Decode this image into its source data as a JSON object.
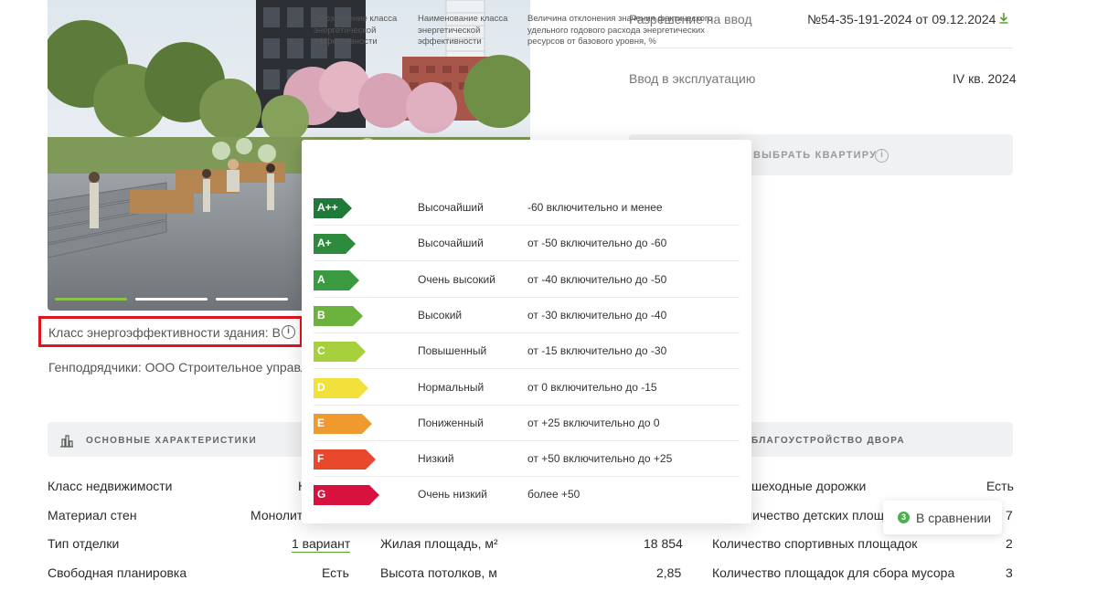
{
  "hero": {
    "slides": 4,
    "active_slide": 1
  },
  "energy": {
    "label": "Класс энергоэффективности здания: В"
  },
  "contractors": {
    "label": "Генподрядчики: ООО Строительное управле"
  },
  "permit": {
    "label": "Разрешение на ввод",
    "value": "№54-35-191-2024 от 09.12.2024"
  },
  "commission": {
    "label": "Ввод в эксплуатацию",
    "value": "IV кв. 2024"
  },
  "choose": {
    "label": "ВЫБРАТЬ КВАРТИРУ"
  },
  "sections": {
    "main_title": "ОСНОВНЫЕ ХАРАКТЕРИСТИКИ",
    "yard_title": "БЛАГОУСТРОЙСТВО ДВОРА"
  },
  "rows": {
    "col1": [
      {
        "label": "Класс недвижимости",
        "value": "К"
      },
      {
        "label": "Материал стен",
        "value": "Монолит"
      },
      {
        "label": "Тип отделки",
        "value": "1 вариант"
      },
      {
        "label": "Свободная планировка",
        "value": "Есть"
      }
    ],
    "col2": [
      {
        "label": "Жилая площадь, м²",
        "value": "18 854"
      },
      {
        "label": "Высота потолков, м",
        "value": "2,85"
      }
    ],
    "col3": [
      {
        "label": "шеходные дорожки",
        "value": "Есть"
      },
      {
        "label": "личество детских площадо",
        "value": "7"
      },
      {
        "label": "Количество спортивных площадок",
        "value": "2"
      },
      {
        "label": "Количество площадок для сбора мусора",
        "value": "3"
      }
    ]
  },
  "compare": {
    "count": "3",
    "label": "В сравнении"
  },
  "popup": {
    "headers": [
      "Обозначение класса энергетической эффективности",
      "Наименование класса энергетической эффективности",
      "Величина отклонения значения фактического удельного годового расхода энергетических ресурсов от базового уровня, %"
    ],
    "classes": [
      {
        "code": "A++",
        "name": "Высочайший",
        "range": "-60 включительно и менее",
        "color": "#1f7a3a"
      },
      {
        "code": "A+",
        "name": "Высочайший",
        "range": "от -50 включительно до -60",
        "color": "#2e8b3e"
      },
      {
        "code": "A",
        "name": "Очень высокий",
        "range": "от -40 включительно до -50",
        "color": "#3b9a3f"
      },
      {
        "code": "B",
        "name": "Высокий",
        "range": "от -30 включительно до -40",
        "color": "#6cb33e"
      },
      {
        "code": "C",
        "name": "Повышенный",
        "range": "от -15 включительно до -30",
        "color": "#a8cf3c"
      },
      {
        "code": "D",
        "name": "Нормальный",
        "range": "от 0 включительно до -15",
        "color": "#f2e13a"
      },
      {
        "code": "E",
        "name": "Пониженный",
        "range": "от +25 включительно до 0",
        "color": "#ef9a2e"
      },
      {
        "code": "F",
        "name": "Низкий",
        "range": "от +50 включительно до +25",
        "color": "#e8482b"
      },
      {
        "code": "G",
        "name": "Очень низкий",
        "range": "более +50",
        "color": "#d8123e"
      }
    ]
  }
}
